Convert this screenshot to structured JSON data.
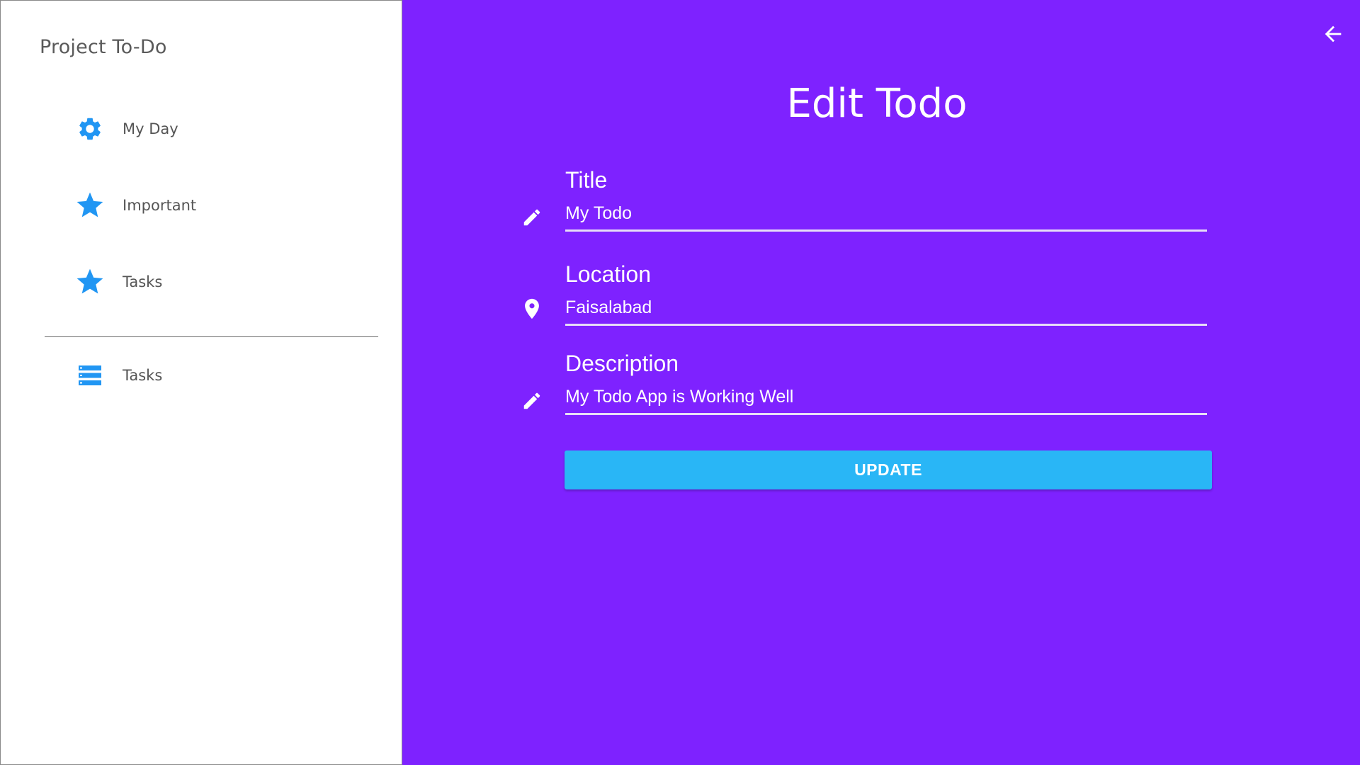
{
  "sidebar": {
    "app_title": "Project To-Do",
    "items": [
      {
        "label": "My Day",
        "icon": "gear-icon"
      },
      {
        "label": "Important",
        "icon": "star-icon"
      },
      {
        "label": "Tasks",
        "icon": "star-icon"
      },
      {
        "label": "Tasks",
        "icon": "list-icon"
      }
    ]
  },
  "header": {
    "back_icon": "arrow-left-icon"
  },
  "main": {
    "title": "Edit Todo",
    "fields": {
      "title": {
        "label": "Title",
        "value": "My Todo",
        "icon": "pencil-icon"
      },
      "location": {
        "label": "Location",
        "value": "Faisalabad",
        "icon": "location-pin-icon"
      },
      "description": {
        "label": "Description",
        "value": "My Todo App is Working Well",
        "icon": "pencil-icon"
      }
    },
    "update_label": "UPDATE"
  },
  "colors": {
    "background": "#7E22FF",
    "accent_icon": "#2196F3",
    "button": "#29B6F6",
    "sidebar_bg": "#FFFFFF"
  }
}
